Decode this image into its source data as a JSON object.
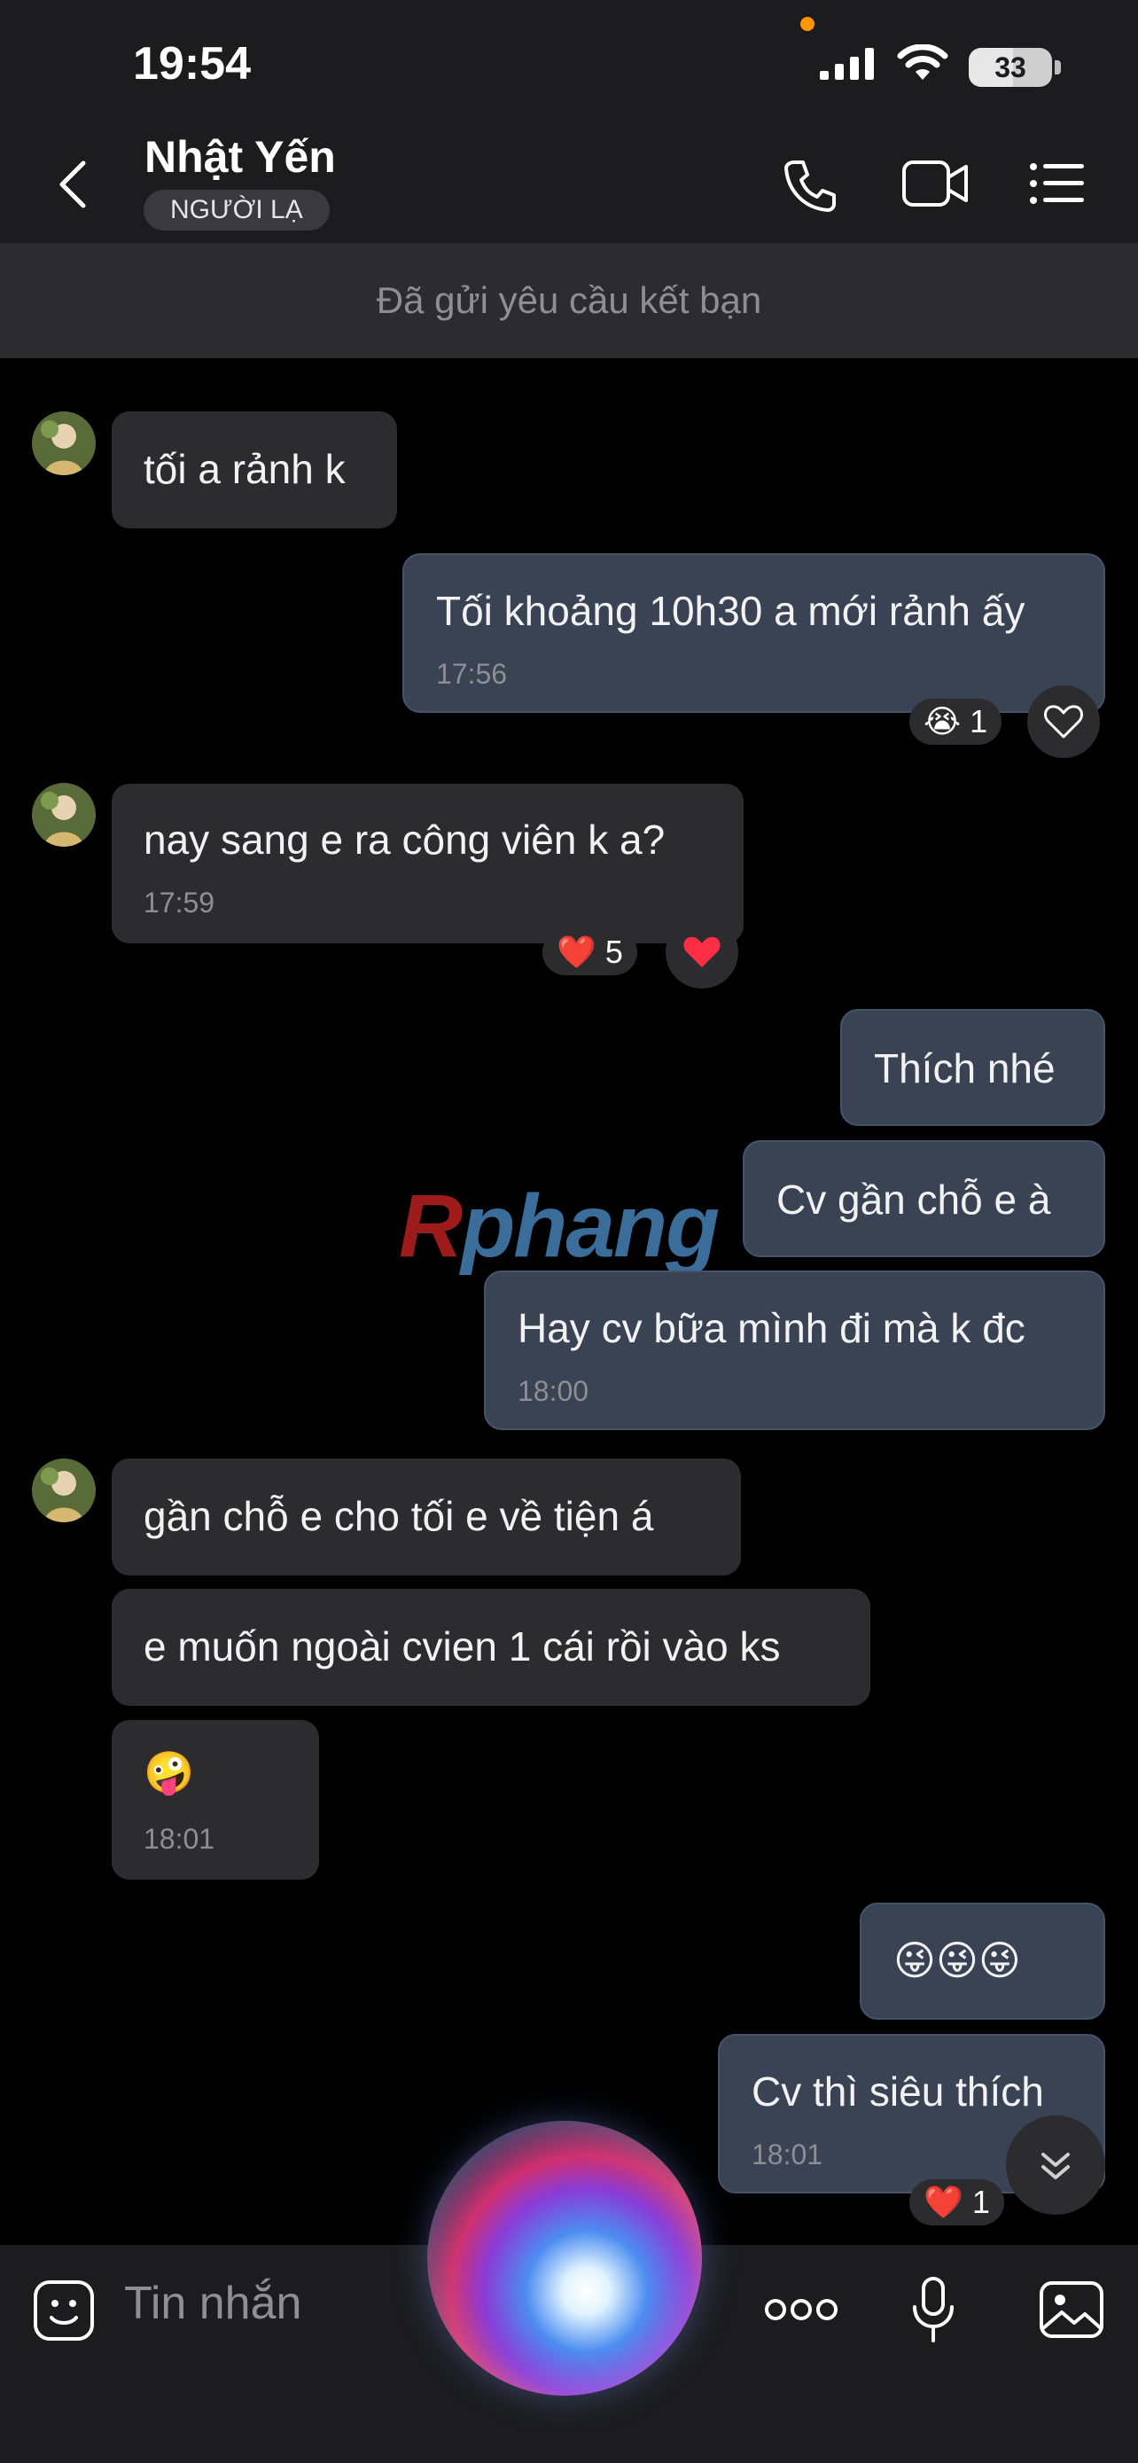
{
  "status_bar": {
    "time": "19:54",
    "battery": "33"
  },
  "header": {
    "name": "Nhật Yến",
    "badge": "NGƯỜI LẠ"
  },
  "banner": {
    "text": "Đã gửi yêu cầu kết bạn"
  },
  "messages": [
    {
      "side": "in",
      "text": "tối a rảnh k"
    },
    {
      "side": "out",
      "text": "Tối khoảng 10h30 a mới rảnh ấy",
      "time": "17:56",
      "reaction": "😭",
      "reaction_count": "1"
    },
    {
      "side": "in",
      "text": "nay sang e ra công viên k a?",
      "time": "17:59",
      "reaction": "❤️",
      "reaction_count": "5"
    },
    {
      "side": "out",
      "text": "Thích nhé"
    },
    {
      "side": "out",
      "text": "Cv gần chỗ e à"
    },
    {
      "side": "out",
      "text": "Hay cv bữa mình đi mà k đc",
      "time": "18:00"
    },
    {
      "side": "in",
      "text": "gần chỗ e cho tối e về tiện á"
    },
    {
      "side": "in",
      "text": "e muốn ngoài cvien 1 cái rồi vào ks"
    },
    {
      "side": "in",
      "text": "🤪",
      "time": "18:01"
    },
    {
      "side": "out",
      "text": "😜😜😜"
    },
    {
      "side": "out",
      "text": "Cv thì siêu thích",
      "time": "18:01",
      "reaction": "❤️",
      "reaction_count": "1"
    }
  ],
  "watermark": {
    "first": "R",
    "rest": "phang"
  },
  "composer": {
    "placeholder": "Tin nhắn"
  },
  "icons": {
    "back": "chevron-left-icon",
    "call": "phone-icon",
    "video": "video-camera-icon",
    "menu": "list-menu-icon",
    "sticker": "sticker-face-icon",
    "more": "more-dots-icon",
    "mic": "microphone-icon",
    "gallery": "image-gallery-icon",
    "scroll": "double-chevron-down-icon"
  },
  "colors": {
    "background": "#000000",
    "incoming_bubble": "#2c2c2e",
    "outgoing_bubble": "#394353",
    "header": "#1c1c1e"
  }
}
